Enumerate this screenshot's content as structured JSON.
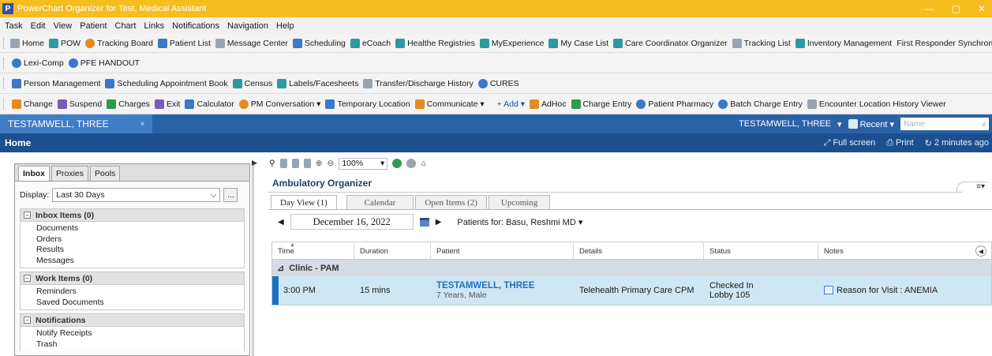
{
  "window": {
    "title": "PowerChart Organizer for Test, Medical Assistant",
    "app_icon_letter": "P",
    "controls": {
      "minimize": "—",
      "maximize": "▢",
      "close": "✕"
    }
  },
  "menu": [
    "Task",
    "Edit",
    "View",
    "Patient",
    "Chart",
    "Links",
    "Notifications",
    "Navigation",
    "Help"
  ],
  "toolbar1": [
    {
      "label": "Home",
      "icon": "home-icon"
    },
    {
      "label": "POW",
      "icon": "grid-icon"
    },
    {
      "label": "Tracking Board",
      "icon": "person-icon"
    },
    {
      "label": "Patient List",
      "icon": "list-icon"
    },
    {
      "label": "Message Center",
      "icon": "envelope-icon"
    },
    {
      "label": "Scheduling",
      "icon": "calendar-icon"
    },
    {
      "label": "eCoach",
      "icon": "grid-icon"
    },
    {
      "label": "Healthe Registries",
      "icon": "grid-icon"
    },
    {
      "label": "MyExperience",
      "icon": "grid-icon"
    },
    {
      "label": "My Case List",
      "icon": "grid-icon"
    },
    {
      "label": "Care Coordinator Organizer",
      "icon": "grid-icon"
    },
    {
      "label": "Tracking List",
      "icon": "document-icon"
    },
    {
      "label": "Inventory Management",
      "icon": "grid-icon"
    },
    {
      "label": "First Responder Synchronization",
      "icon": ""
    }
  ],
  "toolbar2": [
    {
      "label": "Lexi-Comp",
      "icon": "magnifier-icon"
    },
    {
      "label": "PFE HANDOUT",
      "icon": "magnifier-icon"
    }
  ],
  "toolbar3": [
    {
      "label": "Person Management",
      "icon": "window-icon"
    },
    {
      "label": "Scheduling Appointment Book",
      "icon": "window-icon"
    },
    {
      "label": "Census",
      "icon": "table-icon"
    },
    {
      "label": "Labels/Facesheets",
      "icon": "label-icon"
    },
    {
      "label": "Transfer/Discharge History",
      "icon": "history-icon"
    },
    {
      "label": "CURES",
      "icon": "magnifier-icon"
    }
  ],
  "toolbar4": [
    {
      "label": "Change",
      "icon": "change-icon"
    },
    {
      "label": "Suspend",
      "icon": "suspend-icon"
    },
    {
      "label": "Charges",
      "icon": "charges-icon"
    },
    {
      "label": "Exit",
      "icon": "exit-icon"
    },
    {
      "label": "Calculator",
      "icon": "calculator-icon"
    },
    {
      "label": "PM Conversation ▾",
      "icon": "person-icon"
    },
    {
      "label": "Temporary Location",
      "icon": "location-icon"
    },
    {
      "label": "Communicate ▾",
      "icon": "communicate-icon"
    },
    {
      "label": "+ Add ▾",
      "icon": ""
    },
    {
      "label": "AdHoc",
      "icon": "adhoc-icon"
    },
    {
      "label": "Charge Entry",
      "icon": "charge-entry-icon"
    },
    {
      "label": "Patient Pharmacy",
      "icon": "pharmacy-icon"
    },
    {
      "label": "Batch Charge Entry",
      "icon": "batch-icon"
    },
    {
      "label": "Encounter Location History Viewer",
      "icon": "history-icon"
    }
  ],
  "patient_tab": {
    "name": "TESTAMWELL, THREE",
    "close": "×"
  },
  "patient_controls": {
    "patient_name": "TESTAMWELL, THREE",
    "dropdown": "▾",
    "recent": "Recent ▾",
    "name_placeholder": "Name",
    "search": "⌕"
  },
  "home": {
    "label": "Home",
    "full_screen": "Full screen",
    "print": "Print",
    "refresh": "2 minutes ago"
  },
  "inbox": {
    "tabs": [
      "Inbox",
      "Proxies",
      "Pools"
    ],
    "display_label": "Display:",
    "display_value": "Last 30 Days",
    "more_button": "...",
    "sections": [
      {
        "title": "Inbox Items (0)",
        "items": [
          "Documents",
          "Orders",
          "Results",
          "Messages"
        ]
      },
      {
        "title": "Work Items (0)",
        "items": [
          "Reminders",
          "Saved Documents"
        ]
      },
      {
        "title": "Notifications",
        "items": [
          "Notify Receipts",
          "Trash"
        ]
      }
    ]
  },
  "organizer": {
    "zoom": "100%",
    "title": "Ambulatory Organizer",
    "menu": "≡▾",
    "tabs": [
      "Day View (1)",
      "Calendar",
      "Open Items (2)",
      "Upcoming"
    ],
    "date": "December 16, 2022",
    "patients_for": "Patients for: Basu, Reshmi MD ▾",
    "columns": [
      "Time",
      "Duration",
      "Patient",
      "Details",
      "Status",
      "Notes"
    ],
    "group": "Clinic - PAM",
    "rows": [
      {
        "time": "3:00 PM",
        "duration": "15 mins",
        "patient_name": "TESTAMWELL, THREE",
        "patient_sub": "7 Years, Male",
        "details": "Telehealth Primary Care CPM",
        "status_line1": "Checked In",
        "status_line2": "Lobby 105",
        "notes": "Reason for Visit : ANEMIA"
      }
    ]
  }
}
